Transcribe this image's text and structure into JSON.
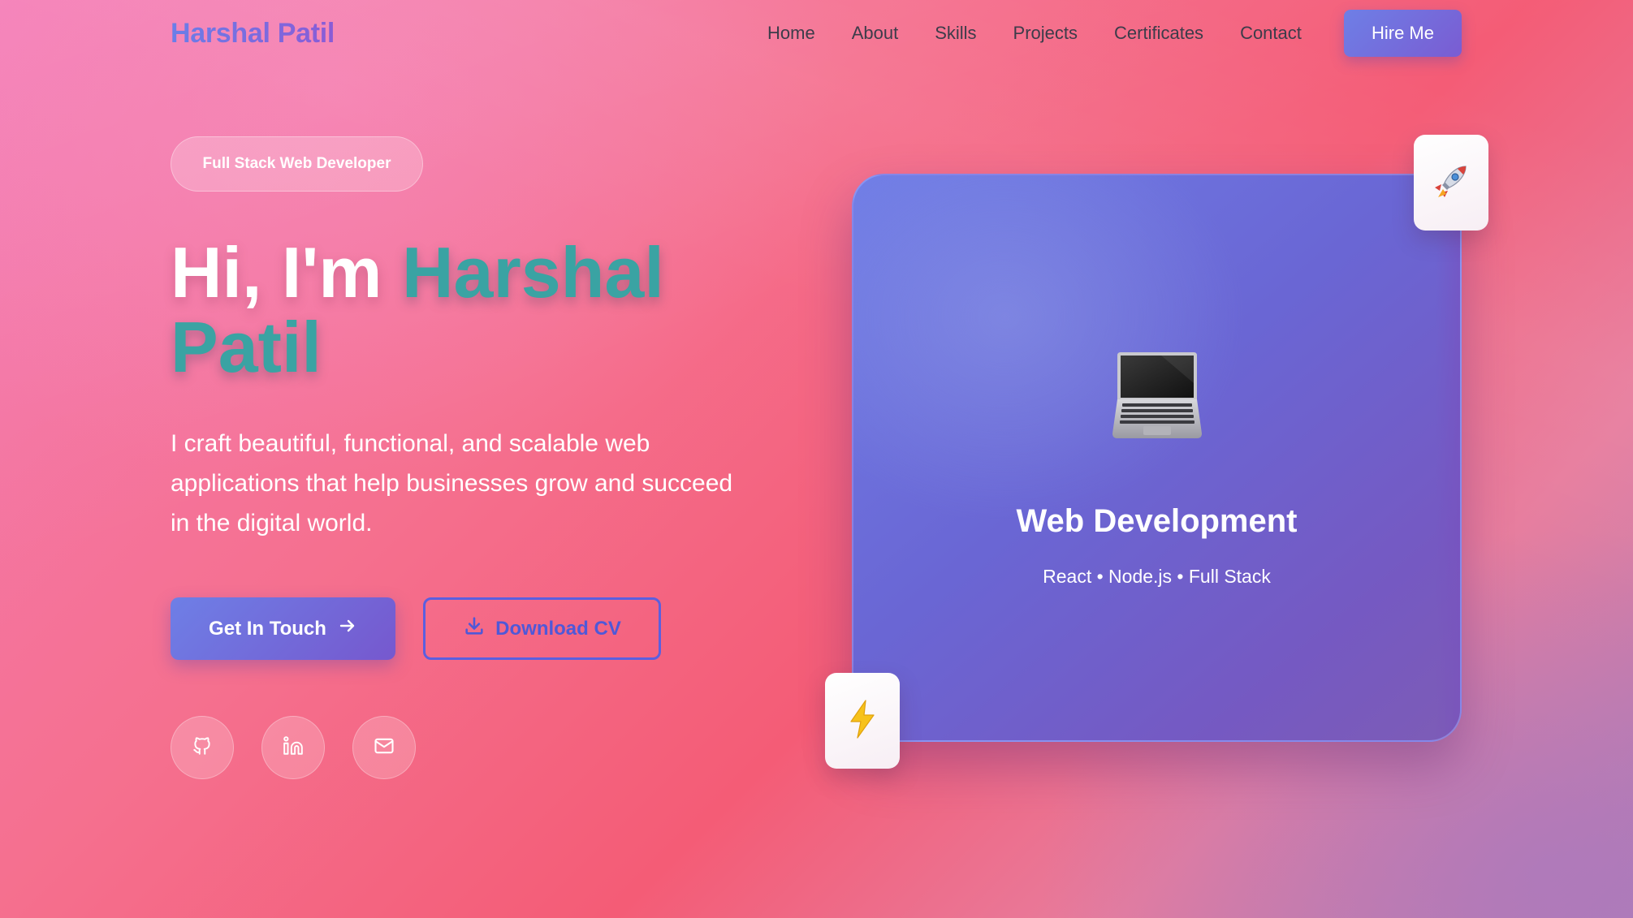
{
  "nav": {
    "logo": "Harshal Patil",
    "links": [
      "Home",
      "About",
      "Skills",
      "Projects",
      "Certificates",
      "Contact"
    ],
    "cta": "Hire Me"
  },
  "hero": {
    "badge": "Full Stack Web Developer",
    "greeting": "Hi, I'm",
    "name_line1": "Harshal",
    "name_line2": "Patil",
    "description": "I craft beautiful, functional, and scalable web applications that help businesses grow and succeed in the digital world.",
    "primary_button": "Get In Touch",
    "secondary_button": "Download CV",
    "social": [
      {
        "icon": "github-icon"
      },
      {
        "icon": "linkedin-icon"
      },
      {
        "icon": "mail-icon"
      }
    ]
  },
  "card": {
    "icon": "laptop-icon",
    "title": "Web Development",
    "subtitle": "React • Node.js • Full Stack",
    "floating_top": "rocket-icon",
    "floating_bottom": "lightning-icon"
  },
  "colors": {
    "accent": "#6e7fe6",
    "accent_dark": "#7658ce",
    "name_teal": "#3aa3a3",
    "outline_blue": "#4f58d8"
  }
}
